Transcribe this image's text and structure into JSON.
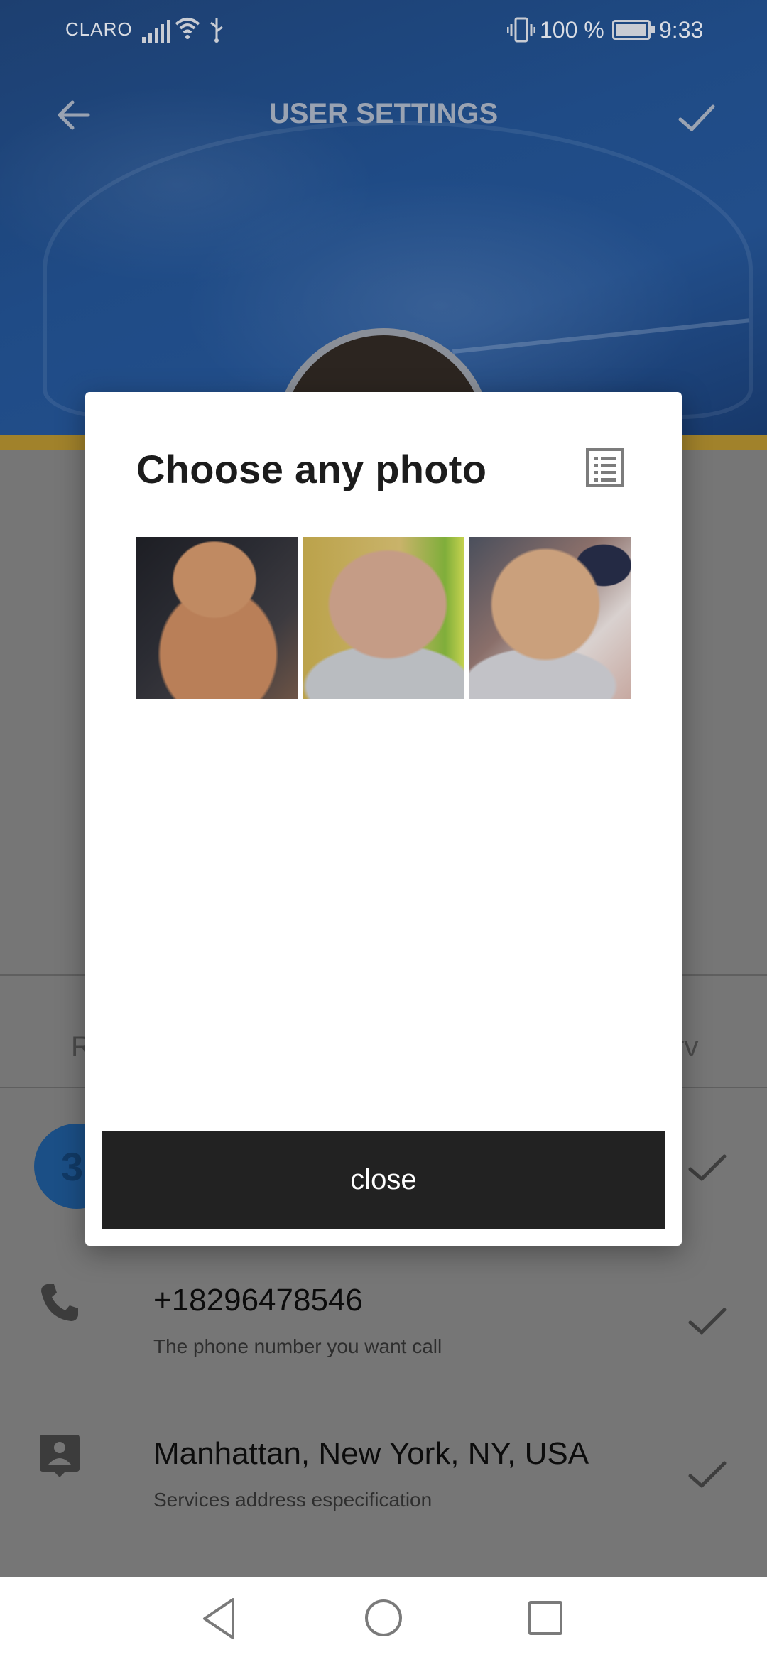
{
  "status_bar": {
    "carrier": "CLARO",
    "battery_pct": "100 %",
    "time": "9:33"
  },
  "app_bar": {
    "title": "USER SETTINGS",
    "back_icon": "arrow-left-icon",
    "confirm_icon": "check-icon"
  },
  "background": {
    "tab_left_peek": "R",
    "tab_right_peek": "rv",
    "badge_text": "3",
    "rows": [
      {
        "icon": "phone-icon",
        "title": "+18296478546",
        "subtitle": "The phone number you want call"
      },
      {
        "icon": "contact-address-icon",
        "title": "Manhattan, New York, NY, USA",
        "subtitle": "Services address especification"
      }
    ]
  },
  "dialog": {
    "title": "Choose any photo",
    "view_toggle_icon": "list-view-icon",
    "photos": [
      "photo-1",
      "photo-2",
      "photo-3"
    ],
    "close_label": "close"
  },
  "nav_bar": {
    "icons": [
      "back-triangle-icon",
      "home-circle-icon",
      "recents-square-icon"
    ]
  },
  "colors": {
    "header_blue": "#1f4b86",
    "accent_gold": "#a1822b",
    "dialog_button": "#222222"
  }
}
